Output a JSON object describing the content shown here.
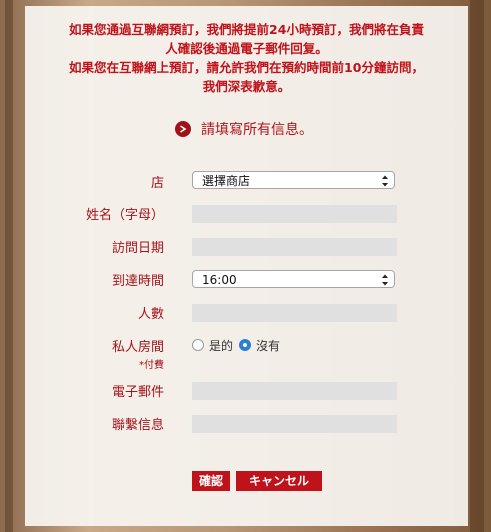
{
  "notice": {
    "line1": "如果您通過互聯網預訂，我們將提前24小時預訂，我們將在負責",
    "line2": "人確認後通過電子郵件回复。",
    "line3": "如果您在互聯網上預訂，請允許我們在預約時間前10分鐘訪問，",
    "line4": "我們深表歉意。"
  },
  "form": {
    "heading": "請填寫所有信息。",
    "store_label": "店",
    "store_value": "選擇商店",
    "name_label": "姓名（字母）",
    "visit_date_label": "訪問日期",
    "arrival_time_label": "到達時間",
    "arrival_time_value": "16:00",
    "people_label": "人數",
    "private_room_label": "私人房間",
    "private_room_note": "*付費",
    "private_room_options": [
      "是的",
      "沒有"
    ],
    "private_room_selected": "沒有",
    "email_label": "電子郵件",
    "contact_label": "聯繫信息"
  },
  "buttons": {
    "confirm": "確認",
    "cancel": "キャンセル"
  },
  "colors": {
    "accent": "#c0121a",
    "label": "#a4141b",
    "field_bg": "#e0e0e0",
    "panel_bg": "#f8f5f1",
    "radio_selected": "#2a7fd6"
  }
}
